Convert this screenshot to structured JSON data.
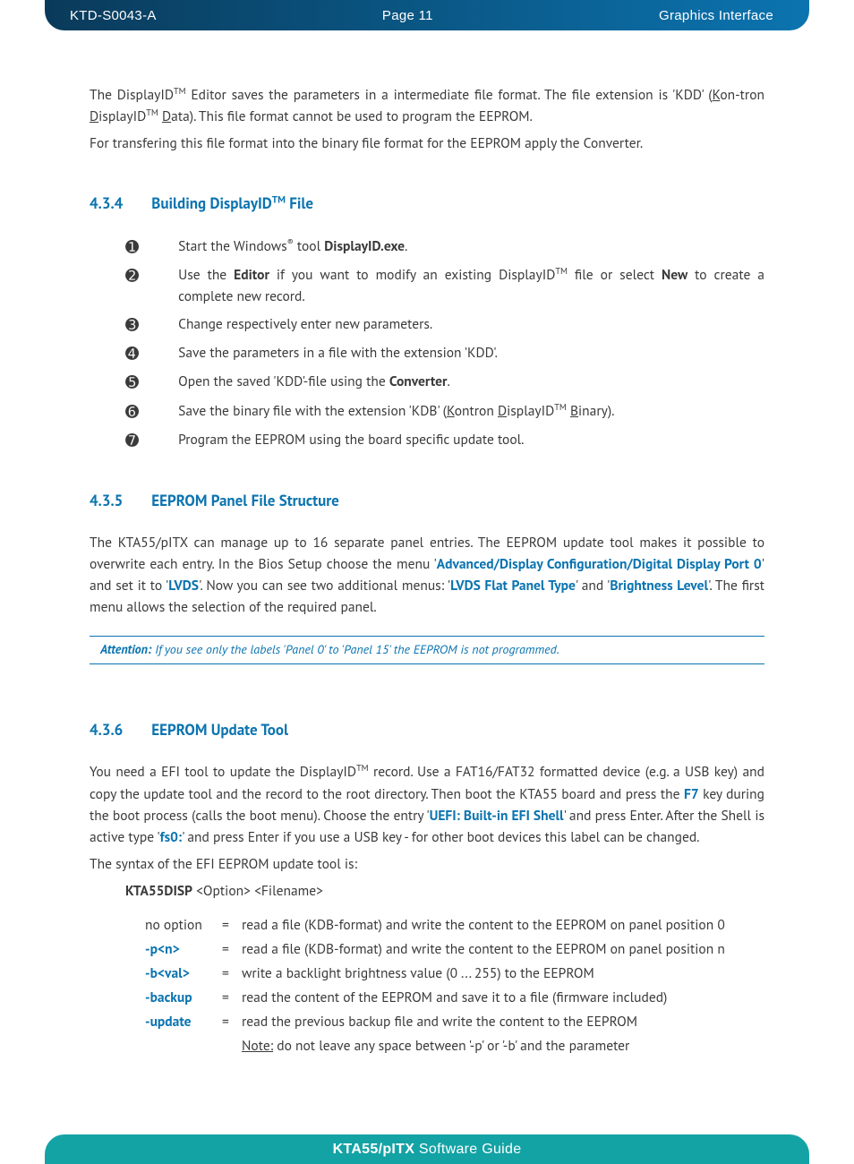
{
  "header": {
    "doc_id": "KTD-S0043-A",
    "page_label": "Page 11",
    "section": "Graphics Interface"
  },
  "intro": {
    "p1_a": "The DisplayID",
    "p1_b": " Editor saves the parameters in a intermediate file format. The file extension is 'KDD' (",
    "p1_c": "on-tron ",
    "p1_d": "isplayID",
    "p1_e": " ",
    "p1_f": "ata). This file format cannot be used to program the EEPROM.",
    "p2": "For transfering this file format into the binary file format for the EEPROM apply the Converter."
  },
  "sec434": {
    "num": "4.3.4",
    "title_a": "Building DisplayID",
    "title_b": " File",
    "steps": [
      {
        "n": "➊",
        "a": "Start the Windows",
        "sup": "®",
        "b": " tool ",
        "bold": "DisplayID.exe",
        "c": "."
      },
      {
        "n": "➋",
        "a": "Use the ",
        "bold1": "Editor",
        "b": " if you want to modify an existing DisplayID",
        "sup": "TM",
        "c": " file or select ",
        "bold2": "New",
        "d": " to create a complete new record."
      },
      {
        "n": "➌",
        "t": "Change respectively enter new parameters."
      },
      {
        "n": "➍",
        "t": "Save the parameters in a file with the extension 'KDD'."
      },
      {
        "n": "➎",
        "a": "Open the saved 'KDD'-file using the ",
        "bold": "Converter",
        "b": "."
      },
      {
        "n": "➏",
        "a": "Save the binary file with the extension 'KDB' (",
        "u1": "K",
        "b": "ontron ",
        "u2": "D",
        "c": "isplayID",
        "sup": "TM",
        "d": " ",
        "u3": "B",
        "e": "inary)."
      },
      {
        "n": "➐",
        "t": "Program the EEPROM using the board specific update tool."
      }
    ]
  },
  "sec435": {
    "num": "4.3.5",
    "title": "EEPROM Panel File Structure",
    "p_a": "The KTA55/pITX can manage up to 16 separate panel entries. The EEPROM update tool makes it possible to overwrite each entry. In the Bios Setup choose the menu '",
    "hl1": "Advanced/Display Configuration/Digital Display Port 0",
    "p_b": "' and set it to '",
    "hl2": "LVDS",
    "p_c": "'. Now you can see two additional menus: '",
    "hl3": "LVDS Flat Panel Type",
    "p_d": "' and '",
    "hl4": "Brightness Level",
    "p_e": "'. The first menu allows the selection of the required panel.",
    "attention_label": "Attention:",
    "attention_text": "  If you see only the labels 'Panel 0' to 'Panel 15' the EEPROM is not programmed."
  },
  "sec436": {
    "num": "4.3.6",
    "title": "EEPROM Update Tool",
    "p_a": "You need a EFI tool to update the DisplayID",
    "p_b": " record. Use a FAT16/FAT32 formatted device (e.g. a USB key) and copy the update tool and the record to the root directory. Then boot the KTA55 board and press the ",
    "hl1": "F7",
    "p_c": " key during the boot process (calls the boot menu). Choose the entry '",
    "hl2": "UEFI: Built-in EFI Shell",
    "p_d": "' and press Enter. After the Shell is active type '",
    "hl3": "fs0:",
    "p_e": "' and press Enter if you use a USB key - for other boot devices this label can be changed.",
    "p2": "The syntax of the EFI EEPROM update tool is:",
    "cmd": "KTA55DISP",
    "cmd_args": "  <Option>  <Filename>",
    "opts": [
      {
        "k": "no option",
        "d": "read a file (KDB-format) and write the content to the EEPROM on panel position 0",
        "blue": false
      },
      {
        "k": "-p<n>",
        "d": "read a file (KDB-format) and write the content to the EEPROM on panel position n",
        "blue": true
      },
      {
        "k": "-b<val>",
        "d": "write a backlight brightness value (0 ... 255) to the EEPROM",
        "blue": true
      },
      {
        "k": "-backup",
        "d": "read the content of the EEPROM and save it to a file (firmware included)",
        "blue": true
      },
      {
        "k": "-update",
        "d": "read the previous backup file and write the content to the EEPROM",
        "blue": true
      }
    ],
    "note_label": "Note:",
    "note_text": " do not leave any space between '-p' or '-b' and the parameter"
  },
  "footer": {
    "bold": "KTA55/pITX",
    "rest": " Software Guide"
  }
}
